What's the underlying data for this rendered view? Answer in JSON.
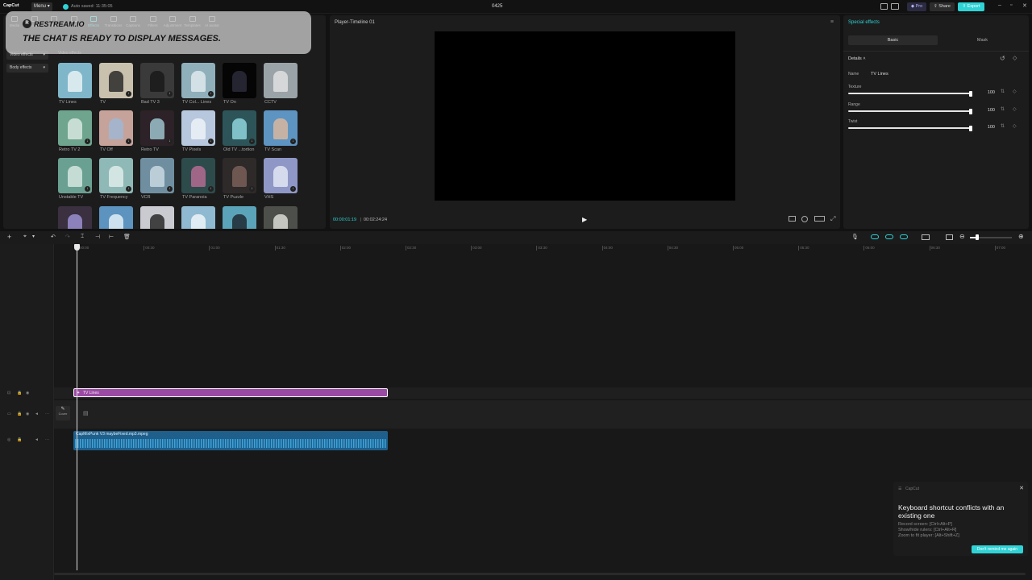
{
  "app": {
    "logo": "CapCut",
    "menu_label": "Menu",
    "autosave": "Auto saved: 11:35:05",
    "project_title": "0425",
    "pro_label": "Pro",
    "share_label": "Share",
    "export_label": "Export"
  },
  "overlay": {
    "brand": "RESTREAM.IO",
    "message": "THE CHAT IS READY TO DISPLAY MESSAGES."
  },
  "tool_tabs": [
    {
      "label": "Media",
      "icon": "media-icon"
    },
    {
      "label": "Audio",
      "icon": "audio-icon"
    },
    {
      "label": "Text",
      "icon": "text-icon"
    },
    {
      "label": "Stickers",
      "icon": "sticker-icon"
    },
    {
      "label": "Effects",
      "icon": "effects-icon"
    },
    {
      "label": "Transitions",
      "icon": "transition-icon"
    },
    {
      "label": "Captions",
      "icon": "captions-icon"
    },
    {
      "label": "Filters",
      "icon": "filters-icon"
    },
    {
      "label": "Adjustment",
      "icon": "adjustment-icon"
    },
    {
      "label": "Templates",
      "icon": "templates-icon"
    },
    {
      "label": "AI avatar",
      "icon": "ai-avatar-icon"
    }
  ],
  "sidebar": {
    "items": [
      {
        "label": "Video effects"
      },
      {
        "label": "Body effects"
      }
    ],
    "section_title": "Video effects"
  },
  "effects": [
    {
      "label": "TV Lines",
      "bg": "#7fb6c9",
      "fg": "#e8f2f4"
    },
    {
      "label": "TV",
      "bg": "#c9c0ad",
      "fg": "#2a2a2a"
    },
    {
      "label": "Bad TV 3",
      "bg": "#3a3a3a",
      "fg": "#1a1a1a"
    },
    {
      "label": "TV Col... Lines",
      "bg": "#8fb0bb",
      "fg": "#dfe9ec"
    },
    {
      "label": "TV On",
      "bg": "#050505",
      "fg": "#2b2b3a"
    },
    {
      "label": "CCTV",
      "bg": "#9aa4a8",
      "fg": "#e0e0e0"
    },
    {
      "label": "Retro TV 2",
      "bg": "#6fa58f",
      "fg": "#d7e6df"
    },
    {
      "label": "TV Off",
      "bg": "#c6a39a",
      "fg": "#9fb7d4"
    },
    {
      "label": "Retro TV",
      "bg": "#2c2228",
      "fg": "#9ec2cb"
    },
    {
      "label": "TV Pixels",
      "bg": "#b7c7dd",
      "fg": "#eef2f7"
    },
    {
      "label": "Old TV ...tortion",
      "bg": "#2d5559",
      "fg": "#8fd3dc"
    },
    {
      "label": "TV Scan",
      "bg": "#5e94c2",
      "fg": "#d8b79f"
    },
    {
      "label": "Unstable TV",
      "bg": "#6aa091",
      "fg": "#d4e6df"
    },
    {
      "label": "TV Frequency",
      "bg": "#8fb9b6",
      "fg": "#dfecea"
    },
    {
      "label": "VCR",
      "bg": "#6f8fa1",
      "fg": "#c9d9e1"
    },
    {
      "label": "TV Paranoia",
      "bg": "#2e4b4c",
      "fg": "#b46b93"
    },
    {
      "label": "TV Puzzle",
      "bg": "#2e2a29",
      "fg": "#7a5f58"
    },
    {
      "label": "VHS",
      "bg": "#8f97c6",
      "fg": "#e2e5f3"
    },
    {
      "label": "",
      "bg": "#3a3040",
      "fg": "#9b8fd1"
    },
    {
      "label": "",
      "bg": "#5c93bf",
      "fg": "#e1eef7"
    },
    {
      "label": "",
      "bg": "#c9cbd1",
      "fg": "#2a2a2a"
    },
    {
      "label": "",
      "bg": "#8fb9d0",
      "fg": "#eef5f9"
    },
    {
      "label": "",
      "bg": "#5ba3b8",
      "fg": "#1f2a33"
    },
    {
      "label": "",
      "bg": "#4d4f4a",
      "fg": "#d9dbd4"
    }
  ],
  "player": {
    "title": "Player-Timeline 01",
    "current_time": "00:00:01:19",
    "total_time": "00:02:24:24"
  },
  "inspector": {
    "panel_title": "Special effects",
    "tabs": [
      "Basic",
      "Mask"
    ],
    "section": "Details",
    "name_label": "Name",
    "name_value": "TV Lines",
    "params": [
      {
        "label": "Texture",
        "value": "100",
        "fraction": 1.0
      },
      {
        "label": "Range",
        "value": "100",
        "fraction": 1.0
      },
      {
        "label": "Twist",
        "value": "100",
        "fraction": 1.0
      }
    ]
  },
  "timeline": {
    "ticks": [
      "00:00",
      "00:30",
      "01:00",
      "01:30",
      "02:00",
      "02:30",
      "03:00",
      "03:30",
      "04:00",
      "04:30",
      "05:00",
      "05:30",
      "06:00",
      "06:30",
      "07:00"
    ],
    "effect_clip": "TV Lines",
    "audio_clip": "CapMixPunk V3 maybeFixed.mp3.mpeg",
    "cover_label": "Cover"
  },
  "toast": {
    "app": "CapCut",
    "title": "Keyboard shortcut conflicts with an existing one",
    "lines": [
      "Record screen: [Ctrl+Alt+P]",
      "Show/hide rulers: [Ctrl+Alt+R]",
      "Zoom to fit player: [Alt+Shift+Z]"
    ],
    "button": "Don't remind me again"
  },
  "colors": {
    "accent": "#2fd3d6",
    "effect_clip": "#9b4aa4",
    "audio_clip": "#1f6d9e"
  }
}
